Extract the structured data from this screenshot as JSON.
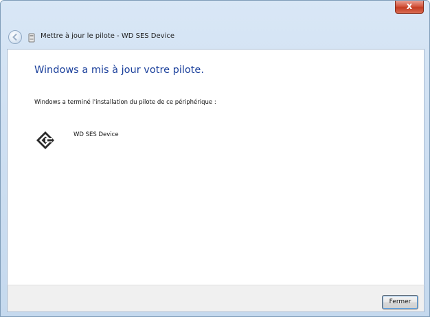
{
  "window": {
    "title": "Mettre à jour le pilote - WD SES Device",
    "close_glyph": "x"
  },
  "content": {
    "heading": "Windows a mis à jour votre pilote.",
    "description": "Windows a terminé l'installation du pilote de ce périphérique :",
    "device_name": "WD SES Device"
  },
  "footer": {
    "close_button_label": "Fermer"
  },
  "icons": {
    "back": "back-arrow-icon",
    "title": "device-icon",
    "device": "wd-ses-device-icon"
  },
  "colors": {
    "heading": "#1a3f9b",
    "title_close": "#c43c22"
  }
}
